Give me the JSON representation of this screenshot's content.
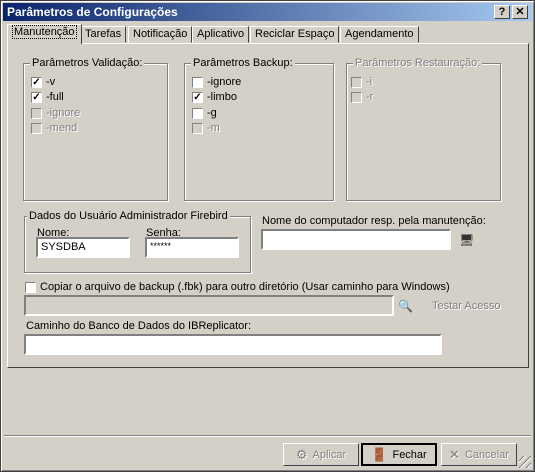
{
  "window": {
    "title": "Parâmetros de Configurações",
    "help_label": "?",
    "close_label": "✕"
  },
  "tabs": [
    {
      "label": "Manutenção",
      "active": true
    },
    {
      "label": "Tarefas"
    },
    {
      "label": "Notificação"
    },
    {
      "label": "Aplicativo"
    },
    {
      "label": "Reciclar Espaço"
    },
    {
      "label": "Agendamento"
    }
  ],
  "validacao": {
    "title": "Parâmetros Validação:",
    "items": [
      {
        "label": "-v",
        "checked": true,
        "enabled": true
      },
      {
        "label": "-full",
        "checked": true,
        "enabled": true
      },
      {
        "label": "-ignore",
        "checked": false,
        "enabled": false
      },
      {
        "label": "-mend",
        "checked": false,
        "enabled": false
      }
    ]
  },
  "backup": {
    "title": "Parâmetros Backup:",
    "items": [
      {
        "label": "-ignore",
        "checked": false,
        "enabled": true
      },
      {
        "label": "-limbo",
        "checked": true,
        "enabled": true
      },
      {
        "label": "-g",
        "checked": false,
        "enabled": true
      },
      {
        "label": "-m",
        "checked": false,
        "enabled": false
      }
    ]
  },
  "restauracao": {
    "title": "Parâmetros Restauração:",
    "items": [
      {
        "label": "-i",
        "checked": false,
        "enabled": false
      },
      {
        "label": "-r",
        "checked": false,
        "enabled": false
      }
    ]
  },
  "admin": {
    "title": "Dados do Usuário Administrador Firebird",
    "nome_label": "Nome:",
    "nome_value": "SYSDBA",
    "senha_label": "Senha:",
    "senha_value": "******"
  },
  "computador": {
    "label": "Nome do computador resp. pela manutenção:",
    "value": ""
  },
  "copiar": {
    "label": "Copiar o arquivo de backup (.fbk) para outro diretório (Usar caminho para Windows)",
    "checked": false,
    "path_value": "",
    "test_label": "Testar Acesso"
  },
  "caminho": {
    "label": "Caminho do Banco de Dados do IBReplicator:",
    "value": ""
  },
  "buttons": {
    "aplicar": "Aplicar",
    "fechar": "Fechar",
    "cancelar": "Cancelar"
  }
}
